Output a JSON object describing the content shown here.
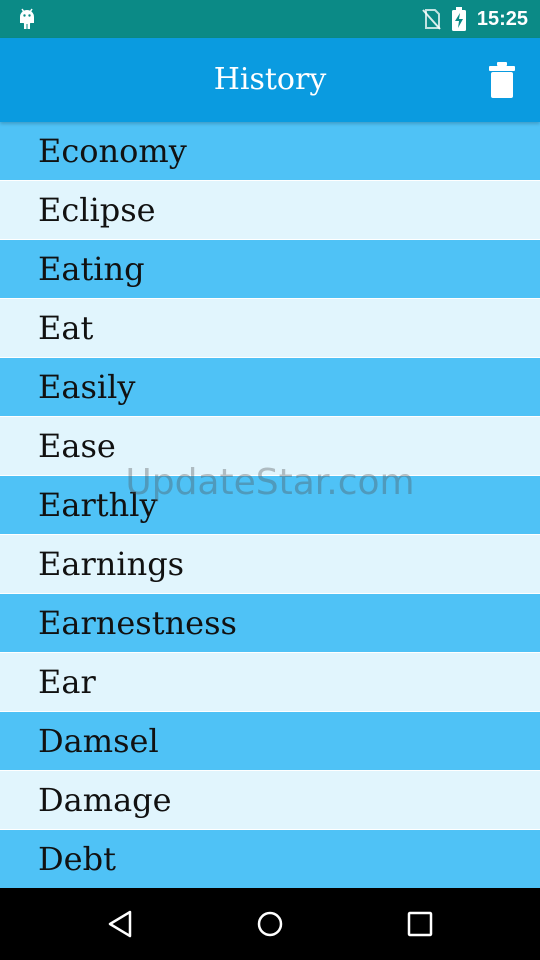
{
  "status_bar": {
    "time": "15:25",
    "left_icon": "android-icon",
    "right_icons": [
      "no-sim-icon",
      "battery-charging-icon"
    ]
  },
  "app_bar": {
    "title": "History",
    "action_icon": "trash-icon"
  },
  "history": {
    "items": [
      {
        "label": "Economy"
      },
      {
        "label": "Eclipse"
      },
      {
        "label": "Eating"
      },
      {
        "label": "Eat"
      },
      {
        "label": "Easily"
      },
      {
        "label": "Ease"
      },
      {
        "label": "Earthly"
      },
      {
        "label": "Earnings"
      },
      {
        "label": "Earnestness"
      },
      {
        "label": "Ear"
      },
      {
        "label": "Damsel"
      },
      {
        "label": "Damage"
      },
      {
        "label": "Debt"
      }
    ]
  },
  "watermark": "UpdateStar.com",
  "colors": {
    "status_bar": "#0b8a86",
    "app_bar": "#0a9be0",
    "row_dark": "#4fc2f6",
    "row_light": "#e1f5fd"
  },
  "nav_bar": {
    "buttons": [
      "back-icon",
      "home-icon",
      "recents-icon"
    ]
  }
}
